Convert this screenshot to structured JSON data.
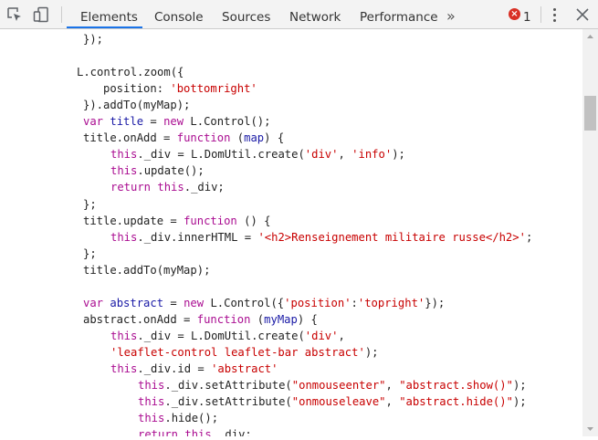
{
  "toolbar": {
    "inspect_icon": "element-picker-icon",
    "device_icon": "device-toolbar-icon",
    "tabs": [
      {
        "label": "Elements",
        "active": true
      },
      {
        "label": "Console",
        "active": false
      },
      {
        "label": "Sources",
        "active": false
      },
      {
        "label": "Network",
        "active": false
      },
      {
        "label": "Performance",
        "active": false
      }
    ],
    "more_tabs": "»",
    "error_count": "1",
    "error_badge_symbol": "×",
    "accent_color": "#1a73e8",
    "error_color": "#d93025"
  },
  "code": {
    "lines": [
      {
        "tokens": [
          {
            "t": "});",
            "c": ""
          }
        ]
      },
      {
        "tokens": []
      },
      {
        "tokens": [
          {
            "t": "L.control.zoom({",
            "c": ""
          }
        ]
      },
      {
        "tokens": [
          {
            "t": "position: ",
            "c": ""
          },
          {
            "t": "'bottomright'",
            "c": "s"
          }
        ]
      },
      {
        "tokens": [
          {
            "t": "}).addTo(myMap);",
            "c": ""
          }
        ]
      },
      {
        "tokens": [
          {
            "t": "var ",
            "c": "k"
          },
          {
            "t": "title",
            "c": "p"
          },
          {
            "t": " = ",
            "c": ""
          },
          {
            "t": "new ",
            "c": "k"
          },
          {
            "t": "L.Control();",
            "c": ""
          }
        ]
      },
      {
        "tokens": [
          {
            "t": "title.onAdd = ",
            "c": ""
          },
          {
            "t": "function ",
            "c": "k"
          },
          {
            "t": "(",
            "c": ""
          },
          {
            "t": "map",
            "c": "p"
          },
          {
            "t": ") {",
            "c": ""
          }
        ]
      },
      {
        "tokens": [
          {
            "t": "this",
            "c": "k"
          },
          {
            "t": "._div = L.DomUtil.create(",
            "c": ""
          },
          {
            "t": "'div'",
            "c": "s"
          },
          {
            "t": ", ",
            "c": ""
          },
          {
            "t": "'info'",
            "c": "s"
          },
          {
            "t": ");",
            "c": ""
          }
        ]
      },
      {
        "tokens": [
          {
            "t": "this",
            "c": "k"
          },
          {
            "t": ".update();",
            "c": ""
          }
        ]
      },
      {
        "tokens": [
          {
            "t": "return ",
            "c": "k"
          },
          {
            "t": "this",
            "c": "k"
          },
          {
            "t": "._div;",
            "c": ""
          }
        ]
      },
      {
        "tokens": [
          {
            "t": "};",
            "c": ""
          }
        ]
      },
      {
        "tokens": [
          {
            "t": "title.update = ",
            "c": ""
          },
          {
            "t": "function ",
            "c": "k"
          },
          {
            "t": "() {",
            "c": ""
          }
        ]
      },
      {
        "tokens": [
          {
            "t": "this",
            "c": "k"
          },
          {
            "t": "._div.innerHTML = ",
            "c": ""
          },
          {
            "t": "'<h2>Renseignement militaire russe</h2>'",
            "c": "s"
          },
          {
            "t": ";",
            "c": ""
          }
        ]
      },
      {
        "tokens": [
          {
            "t": "};",
            "c": ""
          }
        ]
      },
      {
        "tokens": [
          {
            "t": "title.addTo(myMap);",
            "c": ""
          }
        ]
      },
      {
        "tokens": []
      },
      {
        "tokens": [
          {
            "t": "var ",
            "c": "k"
          },
          {
            "t": "abstract",
            "c": "p"
          },
          {
            "t": " = ",
            "c": ""
          },
          {
            "t": "new ",
            "c": "k"
          },
          {
            "t": "L.Control({",
            "c": ""
          },
          {
            "t": "'position'",
            "c": "s"
          },
          {
            "t": ":",
            "c": ""
          },
          {
            "t": "'topright'",
            "c": "s"
          },
          {
            "t": "});",
            "c": ""
          }
        ]
      },
      {
        "tokens": [
          {
            "t": "abstract.onAdd = ",
            "c": ""
          },
          {
            "t": "function ",
            "c": "k"
          },
          {
            "t": "(",
            "c": ""
          },
          {
            "t": "myMap",
            "c": "p"
          },
          {
            "t": ") {",
            "c": ""
          }
        ]
      },
      {
        "tokens": [
          {
            "t": "this",
            "c": "k"
          },
          {
            "t": "._div = L.DomUtil.create(",
            "c": ""
          },
          {
            "t": "'div'",
            "c": "s"
          },
          {
            "t": ",",
            "c": ""
          }
        ]
      },
      {
        "tokens": [
          {
            "t": "'leaflet-control leaflet-bar abstract'",
            "c": "s"
          },
          {
            "t": ");",
            "c": ""
          }
        ]
      },
      {
        "tokens": [
          {
            "t": "this",
            "c": "k"
          },
          {
            "t": "._div.id = ",
            "c": ""
          },
          {
            "t": "'abstract'",
            "c": "s"
          }
        ]
      },
      {
        "tokens": [
          {
            "t": "this",
            "c": "k"
          },
          {
            "t": "._div.setAttribute(",
            "c": ""
          },
          {
            "t": "\"onmouseenter\"",
            "c": "s"
          },
          {
            "t": ", ",
            "c": ""
          },
          {
            "t": "\"abstract.show()\"",
            "c": "s"
          },
          {
            "t": ");",
            "c": ""
          }
        ]
      },
      {
        "tokens": [
          {
            "t": "this",
            "c": "k"
          },
          {
            "t": "._div.setAttribute(",
            "c": ""
          },
          {
            "t": "\"onmouseleave\"",
            "c": "s"
          },
          {
            "t": ", ",
            "c": ""
          },
          {
            "t": "\"abstract.hide()\"",
            "c": "s"
          },
          {
            "t": ");",
            "c": ""
          }
        ]
      },
      {
        "tokens": [
          {
            "t": "this",
            "c": "k"
          },
          {
            "t": ".hide();",
            "c": ""
          }
        ]
      },
      {
        "tokens": [
          {
            "t": "return ",
            "c": "k"
          },
          {
            "t": "this",
            "c": "k"
          },
          {
            "t": "._div;",
            "c": ""
          }
        ]
      }
    ]
  },
  "scrollbar": {
    "up_icon": "scroll-up-arrow-icon",
    "down_icon": "scroll-down-arrow-icon"
  }
}
